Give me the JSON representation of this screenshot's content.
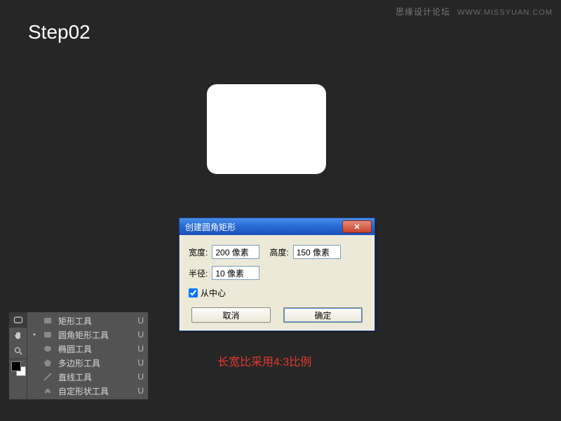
{
  "watermark": {
    "cn": "思缘设计论坛",
    "url": "WWW.MISSYUAN.COM"
  },
  "step_title": "Step02",
  "dialog": {
    "title": "创建圆角矩形",
    "close_glyph": "✕",
    "width_label": "宽度:",
    "width_value": "200 像素",
    "height_label": "高度:",
    "height_value": "150 像素",
    "radius_label": "半径:",
    "radius_value": "10 像素",
    "from_center_label": "从中心",
    "from_center_checked": true,
    "cancel_label": "取消",
    "ok_label": "确定"
  },
  "ratio_note": "长宽比采用4:3比例",
  "tool_panel": {
    "items": [
      {
        "label": "矩形工具",
        "key": "U",
        "selected": false,
        "shape": "rect"
      },
      {
        "label": "圆角矩形工具",
        "key": "U",
        "selected": true,
        "shape": "roundrect"
      },
      {
        "label": "椭圆工具",
        "key": "U",
        "selected": false,
        "shape": "ellipse"
      },
      {
        "label": "多边形工具",
        "key": "U",
        "selected": false,
        "shape": "polygon"
      },
      {
        "label": "直线工具",
        "key": "U",
        "selected": false,
        "shape": "line"
      },
      {
        "label": "自定形状工具",
        "key": "U",
        "selected": false,
        "shape": "custom"
      }
    ]
  }
}
